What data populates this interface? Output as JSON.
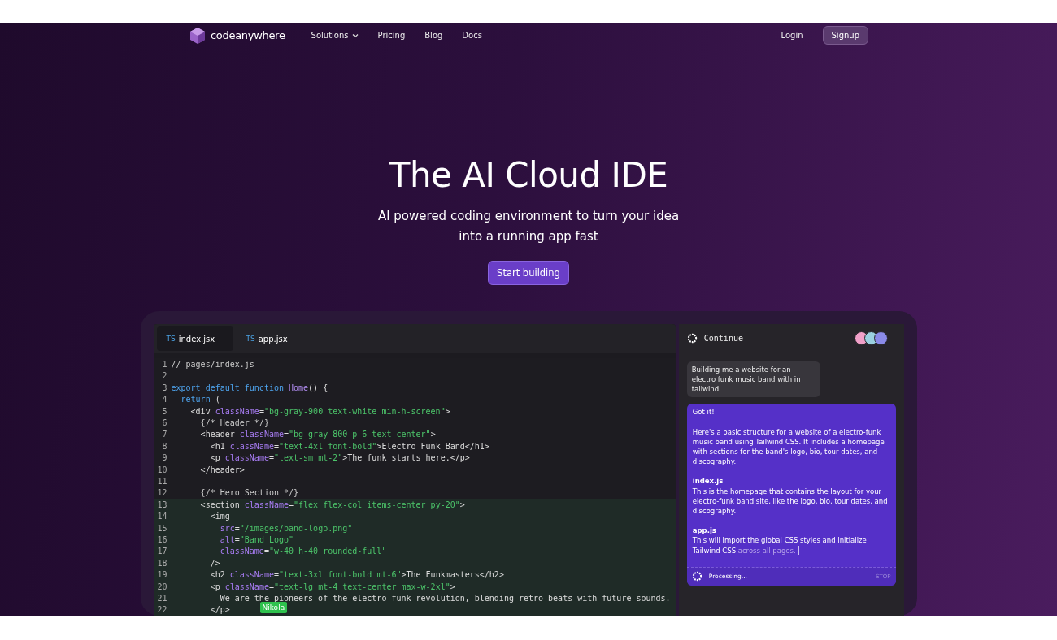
{
  "nav": {
    "logo": "codeanywhere",
    "items": [
      {
        "label": "Solutions",
        "kind": "dropdown"
      },
      {
        "label": "Pricing",
        "kind": "link"
      },
      {
        "label": "Blog",
        "kind": "link"
      },
      {
        "label": "Docs",
        "kind": "link"
      }
    ],
    "login": "Login",
    "signup": "Signup"
  },
  "hero": {
    "title": "The AI Cloud IDE",
    "subtitle": "AI powered coding environment to turn your idea into a running app fast",
    "cta": "Start building"
  },
  "editor": {
    "tabs": [
      {
        "badge": "TS",
        "label": "index.jsx",
        "selected": true
      },
      {
        "badge": "TS",
        "label": "app.jsx",
        "selected": false
      }
    ],
    "lines": [
      {
        "number": "1",
        "highlighted": false,
        "tokens": [
          {
            "kind": "comment",
            "text": "// pages/index.js"
          }
        ]
      },
      {
        "number": "2",
        "highlighted": false
      },
      {
        "number": "3",
        "highlighted": false,
        "tokens": [
          {
            "kind": "keyword",
            "text": "export default function "
          },
          {
            "kind": "fn",
            "text": "Home"
          },
          {
            "kind": "plain",
            "text": "() {"
          }
        ]
      },
      {
        "number": "4",
        "highlighted": false,
        "tokens": [
          {
            "kind": "keyword",
            "text": "  return"
          },
          {
            "kind": "plain",
            "text": " ("
          }
        ]
      },
      {
        "number": "5",
        "highlighted": false,
        "tokens": [
          {
            "kind": "plain",
            "text": "    <div "
          },
          {
            "kind": "attr",
            "text": "className"
          },
          {
            "kind": "plain",
            "text": "="
          },
          {
            "kind": "string",
            "text": "\"bg-gray-900 text-white min-h-screen\""
          },
          {
            "kind": "plain",
            "text": ">"
          }
        ]
      },
      {
        "number": "6",
        "highlighted": false,
        "tokens": [
          {
            "kind": "comment",
            "text": "      {/* Header */}"
          }
        ]
      },
      {
        "number": "7",
        "highlighted": false,
        "tokens": [
          {
            "kind": "plain",
            "text": "      <header "
          },
          {
            "kind": "attr",
            "text": "className"
          },
          {
            "kind": "plain",
            "text": "="
          },
          {
            "kind": "string",
            "text": "\"bg-gray-800 p-6 text-center\""
          },
          {
            "kind": "plain",
            "text": ">"
          }
        ]
      },
      {
        "number": "8",
        "highlighted": false,
        "tokens": [
          {
            "kind": "plain",
            "text": "        <h1 "
          },
          {
            "kind": "attr",
            "text": "className"
          },
          {
            "kind": "plain",
            "text": "="
          },
          {
            "kind": "string",
            "text": "\"text-4xl font-bold\""
          },
          {
            "kind": "plain",
            "text": ">Electro Funk Band</h1>"
          }
        ]
      },
      {
        "number": "9",
        "highlighted": false,
        "tokens": [
          {
            "kind": "plain",
            "text": "        <p "
          },
          {
            "kind": "attr",
            "text": "className"
          },
          {
            "kind": "plain",
            "text": "="
          },
          {
            "kind": "string",
            "text": "\"text-sm mt-2\""
          },
          {
            "kind": "plain",
            "text": ">The funk starts here.</p>"
          }
        ]
      },
      {
        "number": "10",
        "highlighted": false,
        "tokens": [
          {
            "kind": "plain",
            "text": "      </header>"
          }
        ]
      },
      {
        "number": "11",
        "highlighted": false
      },
      {
        "number": "12",
        "highlighted": false,
        "tokens": [
          {
            "kind": "comment",
            "text": "      {/* Hero Section */}"
          }
        ]
      },
      {
        "number": "13",
        "highlighted": true,
        "tokens": [
          {
            "kind": "plain",
            "text": "      <section "
          },
          {
            "kind": "attr",
            "text": "className"
          },
          {
            "kind": "plain",
            "text": "="
          },
          {
            "kind": "string",
            "text": "\"flex flex-col items-center py-20\""
          },
          {
            "kind": "plain",
            "text": ">"
          }
        ]
      },
      {
        "number": "14",
        "highlighted": true,
        "tokens": [
          {
            "kind": "plain",
            "text": "        <img"
          }
        ]
      },
      {
        "number": "15",
        "highlighted": true,
        "tokens": [
          {
            "kind": "attr",
            "text": "          src"
          },
          {
            "kind": "plain",
            "text": "="
          },
          {
            "kind": "string",
            "text": "\"/images/band-logo.png\""
          }
        ]
      },
      {
        "number": "16",
        "highlighted": true,
        "tokens": [
          {
            "kind": "attr",
            "text": "          alt"
          },
          {
            "kind": "plain",
            "text": "="
          },
          {
            "kind": "string",
            "text": "\"Band Logo\""
          }
        ]
      },
      {
        "number": "17",
        "highlighted": true,
        "tokens": [
          {
            "kind": "attr",
            "text": "          className"
          },
          {
            "kind": "plain",
            "text": "="
          },
          {
            "kind": "string",
            "text": "\"w-40 h-40 rounded-full\""
          }
        ]
      },
      {
        "number": "18",
        "highlighted": true,
        "tokens": [
          {
            "kind": "plain",
            "text": "        />"
          }
        ]
      },
      {
        "number": "19",
        "highlighted": true,
        "tokens": [
          {
            "kind": "plain",
            "text": "        <h2 "
          },
          {
            "kind": "attr",
            "text": "className"
          },
          {
            "kind": "plain",
            "text": "="
          },
          {
            "kind": "string",
            "text": "\"text-3xl font-bold mt-6\""
          },
          {
            "kind": "plain",
            "text": ">The Funkmasters</h2>"
          }
        ]
      },
      {
        "number": "20",
        "highlighted": true,
        "tokens": [
          {
            "kind": "plain",
            "text": "        <p "
          },
          {
            "kind": "attr",
            "text": "className"
          },
          {
            "kind": "plain",
            "text": "="
          },
          {
            "kind": "string",
            "text": "\"text-lg mt-4 text-center max-w-2xl\""
          },
          {
            "kind": "plain",
            "text": ">"
          }
        ]
      },
      {
        "number": "21",
        "highlighted": true,
        "tokens": [
          {
            "kind": "plain",
            "text": "          We are the pioneers of the electro-funk revolution, blending retro beats with future sounds."
          }
        ]
      },
      {
        "number": "22",
        "highlighted": true,
        "tokens": [
          {
            "kind": "plain",
            "text": "        </p>"
          }
        ]
      }
    ],
    "cursor_label": "Nikola"
  },
  "chat": {
    "title": "Continue",
    "avatars": [
      {
        "color": "#f0a0c8"
      },
      {
        "color": "#9ad0e0"
      },
      {
        "color": "#8a8ae8"
      }
    ],
    "user_message": "Building me a website for an electro funk music band with in tailwind.",
    "reply": [
      {
        "kind": "text",
        "text": "Got it!"
      },
      {
        "kind": "text",
        "text": "Here's a basic structure for a website of a electro-funk music band using Tailwind CSS. It includes a homepage with sections for the band's logo, bio, tour dates, and discography."
      },
      {
        "kind": "heading",
        "text": "index.js"
      },
      {
        "kind": "text",
        "text": "This is the homepage that contains the layout for your electro-funk band site, like the logo, bio, tour dates, and discography."
      },
      {
        "kind": "heading",
        "text": "app.js"
      },
      {
        "kind": "text",
        "text": "This will import the global CSS styles and initialize Tailwind CSS",
        "pending": " across all pages."
      }
    ],
    "status": "Processing...",
    "stop": {
      "label": "STOP",
      "disabled": true
    }
  }
}
